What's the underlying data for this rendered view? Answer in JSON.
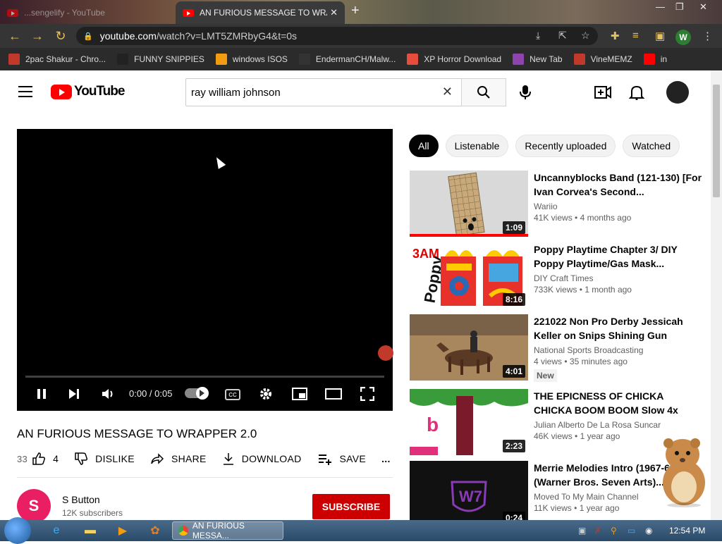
{
  "browser": {
    "tabs": [
      {
        "label": "...sengelify - YouTube",
        "active": false
      },
      {
        "label": "AN FURIOUS MESSAGE TO WRAI",
        "active": true
      }
    ],
    "new_tab": "+",
    "url_host": "youtube.com",
    "url_path": "/watch?v=LMT5ZMRbyG4&t=0s",
    "profile_initial": "W",
    "bookmarks": [
      {
        "label": "2pac Shakur - Chro...",
        "icon": "2pac-icon",
        "color": "#c0392b"
      },
      {
        "label": "FUNNY SNIPPIES",
        "icon": "h-icon",
        "color": "#222222"
      },
      {
        "label": "windows ISOS",
        "icon": "ph-icon",
        "color": "#f39c12"
      },
      {
        "label": "EndermanCH/Malw...",
        "icon": "yp-icon",
        "color": "#333333"
      },
      {
        "label": "XP Horror Download",
        "icon": "x-icon",
        "color": "#e74c3c"
      },
      {
        "label": "New Tab",
        "icon": "globe-icon",
        "color": "#8e44ad"
      },
      {
        "label": "VineMEMZ",
        "icon": "r-icon",
        "color": "#c0392b"
      },
      {
        "label": "in",
        "icon": "youtube-icon",
        "color": "#ff0000"
      }
    ]
  },
  "youtube": {
    "logo_text": "YouTube",
    "search_value": "ray william johnson",
    "video": {
      "time": "0:00 / 0:05",
      "cc": "CC",
      "title": "AN FURIOUS MESSAGE TO WRAPPER 2.0",
      "views_partial": "33",
      "likes": "4",
      "dislike_label": "DISLIKE",
      "share_label": "SHARE",
      "download_label": "DOWNLOAD",
      "save_label": "SAVE",
      "more_label": "...",
      "channel": {
        "name": "S Button",
        "subs": "12K subscribers",
        "initial": "S"
      },
      "subscribe_label": "SUBSCRIBE"
    },
    "chips": [
      "All",
      "Listenable",
      "Recently uploaded",
      "Watched"
    ],
    "recommendations": [
      {
        "title": "Uncannyblocks Band (121-130) [For Ivan Corvea's Second...",
        "channel": "Wariio",
        "views": "41K views",
        "age": "4 months ago",
        "duration": "1:09",
        "badge": "",
        "thumb": "grid"
      },
      {
        "title": "Poppy Playtime Chapter 3/ DIY Poppy Playtime/Gas Mask...",
        "channel": "DIY Craft Times",
        "views": "733K views",
        "age": "1 month ago",
        "duration": "8:16",
        "badge": "",
        "thumb": "poppy"
      },
      {
        "title": "221022 Non Pro Derby Jessicah Keller on Snips Shining Gun",
        "channel": "National Sports Broadcasting",
        "views": "4 views",
        "age": "35 minutes ago",
        "duration": "4:01",
        "badge": "New",
        "thumb": "horse"
      },
      {
        "title": "THE EPICNESS OF CHICKA CHICKA BOOM BOOM Slow 4x",
        "channel": "Julian Alberto De La Rosa Suncar",
        "views": "46K views",
        "age": "1 year ago",
        "duration": "2:23",
        "badge": "",
        "thumb": "tree"
      },
      {
        "title": "Merrie Melodies Intro (1967-69) (Warner Bros. Seven Arts)...",
        "channel": "Moved To My Main Channel",
        "views": "11K views",
        "age": "1 year ago",
        "duration": "0:24",
        "badge": "",
        "thumb": "wb"
      }
    ]
  },
  "taskbar": {
    "task_label": "AN FURIOUS MESSA...",
    "clock": "12:54 PM"
  }
}
